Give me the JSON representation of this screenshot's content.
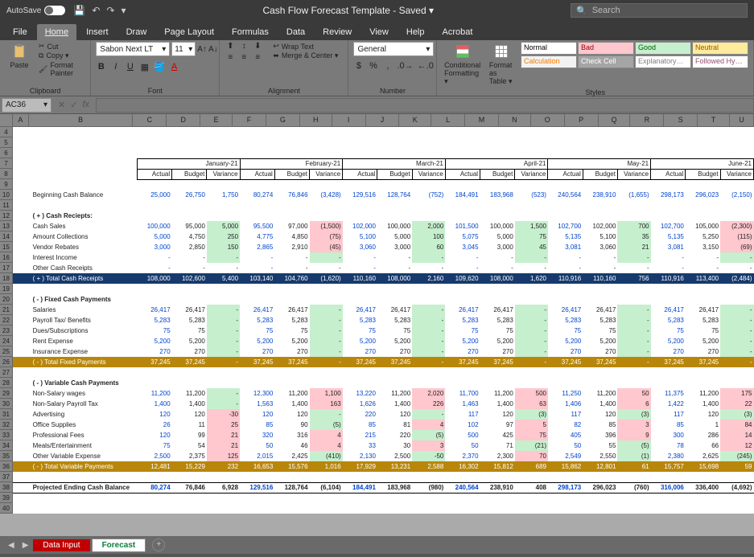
{
  "titlebar": {
    "autosave": "AutoSave",
    "doc": "Cash Flow Forecast Template - Saved ▾",
    "search_ph": "Search"
  },
  "tabs": [
    "File",
    "Home",
    "Insert",
    "Draw",
    "Page Layout",
    "Formulas",
    "Data",
    "Review",
    "View",
    "Help",
    "Acrobat"
  ],
  "active_tab": 1,
  "ribbon": {
    "clipboard": {
      "paste": "Paste",
      "cut": "Cut",
      "copy": "Copy ▾",
      "fp": "Format Painter",
      "label": "Clipboard"
    },
    "font": {
      "name": "Sabon Next LT",
      "size": "11",
      "label": "Font"
    },
    "alignment": {
      "wrap": "Wrap Text",
      "merge": "Merge & Center ▾",
      "label": "Alignment"
    },
    "number": {
      "fmt": "General",
      "label": "Number"
    },
    "styles": {
      "cond": "Conditional Formatting ▾",
      "fat": "Format as Table ▾",
      "label": "Styles",
      "cells": [
        {
          "t": "Normal",
          "bg": "#fff",
          "fg": "#000"
        },
        {
          "t": "Bad",
          "bg": "#ffc7ce",
          "fg": "#9c0006"
        },
        {
          "t": "Good",
          "bg": "#c6efce",
          "fg": "#006100"
        },
        {
          "t": "Neutral",
          "bg": "#ffeb9c",
          "fg": "#9c5700"
        },
        {
          "t": "Calculation",
          "bg": "#f2f2f2",
          "fg": "#fa7d00"
        },
        {
          "t": "Check Cell",
          "bg": "#a5a5a5",
          "fg": "#fff"
        },
        {
          "t": "Explanatory…",
          "bg": "#fff",
          "fg": "#7f7f7f"
        },
        {
          "t": "Followed Hy…",
          "bg": "#fff",
          "fg": "#954f72"
        }
      ]
    }
  },
  "namebox": "AC36",
  "cols": [
    "",
    "A",
    "B",
    "C",
    "D",
    "E",
    "F",
    "G",
    "H",
    "I",
    "J",
    "K",
    "L",
    "M",
    "N",
    "O",
    "P",
    "Q",
    "R",
    "S",
    "T",
    "U"
  ],
  "rows_start": 4,
  "rows_end": 40,
  "months": [
    "January-21",
    "February-21",
    "March-21",
    "April-21",
    "May-21",
    "June-21"
  ],
  "subcols": [
    "Actual",
    "Budget",
    "Variance"
  ],
  "beginning_label": "Beginning Cash Balance",
  "beginning": [
    [
      "25,000",
      "26,750",
      "1,750"
    ],
    [
      "80,274",
      "76,846",
      "(3,428)"
    ],
    [
      "129,516",
      "128,764",
      "(752)"
    ],
    [
      "184,491",
      "183,968",
      "(523)"
    ],
    [
      "240,564",
      "238,910",
      "(1,655)"
    ],
    [
      "298,173",
      "296,023",
      "(2,150)"
    ]
  ],
  "receipts_hdr": "( + ) Cash Reciepts:",
  "receipts": [
    {
      "l": "Cash Sales",
      "v": [
        [
          "100,000",
          "95,000",
          "5,000",
          "g"
        ],
        [
          "95,500",
          "97,000",
          "(1,500)",
          "r"
        ],
        [
          "102,000",
          "100,000",
          "2,000",
          "g"
        ],
        [
          "101,500",
          "100,000",
          "1,500",
          "g"
        ],
        [
          "102,700",
          "102,000",
          "700",
          "g"
        ],
        [
          "102,700",
          "105,000",
          "(2,300)",
          "r"
        ]
      ]
    },
    {
      "l": "Amount Collections",
      "v": [
        [
          "5,000",
          "4,750",
          "250",
          "g"
        ],
        [
          "4,775",
          "4,850",
          "(75)",
          "r"
        ],
        [
          "5,100",
          "5,000",
          "100",
          "g"
        ],
        [
          "5,075",
          "5,000",
          "75",
          "g"
        ],
        [
          "5,135",
          "5,100",
          "35",
          "g"
        ],
        [
          "5,135",
          "5,250",
          "(115)",
          "r"
        ]
      ]
    },
    {
      "l": "Vendor Rebates",
      "v": [
        [
          "3,000",
          "2,850",
          "150",
          "g"
        ],
        [
          "2,865",
          "2,910",
          "(45)",
          "r"
        ],
        [
          "3,060",
          "3,000",
          "60",
          "g"
        ],
        [
          "3,045",
          "3,000",
          "45",
          "g"
        ],
        [
          "3,081",
          "3,060",
          "21",
          "g"
        ],
        [
          "3,081",
          "3,150",
          "(69)",
          "r"
        ]
      ]
    },
    {
      "l": "Interest Income",
      "v": [
        [
          "-",
          "-",
          "-",
          "g"
        ],
        [
          "-",
          "-",
          "-",
          "g"
        ],
        [
          "-",
          "-",
          "-",
          "g"
        ],
        [
          "-",
          "-",
          "-",
          "g"
        ],
        [
          "-",
          "-",
          "-",
          "g"
        ],
        [
          "-",
          "-",
          "-",
          "g"
        ]
      ]
    },
    {
      "l": "Other Cash Receipts",
      "v": [
        [
          "-",
          "-",
          "-",
          ""
        ],
        [
          "-",
          "-",
          "-",
          ""
        ],
        [
          "-",
          "-",
          "-",
          ""
        ],
        [
          "-",
          "-",
          "-",
          ""
        ],
        [
          "-",
          "-",
          "-",
          ""
        ],
        [
          "-",
          "-",
          "-",
          ""
        ]
      ]
    }
  ],
  "receipts_total": {
    "l": "( + ) Total Cash Receipts",
    "v": [
      [
        "108,000",
        "102,600",
        "5,400"
      ],
      [
        "103,140",
        "104,760",
        "(1,620)"
      ],
      [
        "110,160",
        "108,000",
        "2,160"
      ],
      [
        "109,620",
        "108,000",
        "1,620"
      ],
      [
        "110,916",
        "110,160",
        "756"
      ],
      [
        "110,916",
        "113,400",
        "(2,484)"
      ]
    ]
  },
  "fixed_hdr": "( - ) Fixed Cash Payments",
  "fixed": [
    {
      "l": "Salaries",
      "v": [
        [
          "26,417",
          "26,417",
          "-",
          "g"
        ],
        [
          "26,417",
          "26,417",
          "-",
          "g"
        ],
        [
          "26,417",
          "26,417",
          "-",
          "g"
        ],
        [
          "26,417",
          "26,417",
          "-",
          "g"
        ],
        [
          "26,417",
          "26,417",
          "-",
          "g"
        ],
        [
          "26,417",
          "26,417",
          "-",
          "g"
        ]
      ]
    },
    {
      "l": "Payroll Tax/ Benefits",
      "v": [
        [
          "5,283",
          "5,283",
          "-",
          "g"
        ],
        [
          "5,283",
          "5,283",
          "-",
          "g"
        ],
        [
          "5,283",
          "5,283",
          "-",
          "g"
        ],
        [
          "5,283",
          "5,283",
          "-",
          "g"
        ],
        [
          "5,283",
          "5,283",
          "-",
          "g"
        ],
        [
          "5,283",
          "5,283",
          "-",
          "g"
        ]
      ]
    },
    {
      "l": "Dues/Subscriptions",
      "v": [
        [
          "75",
          "75",
          "-",
          "g"
        ],
        [
          "75",
          "75",
          "-",
          "g"
        ],
        [
          "75",
          "75",
          "-",
          "g"
        ],
        [
          "75",
          "75",
          "-",
          "g"
        ],
        [
          "75",
          "75",
          "-",
          "g"
        ],
        [
          "75",
          "75",
          "-",
          "g"
        ]
      ]
    },
    {
      "l": "Rent Expense",
      "v": [
        [
          "5,200",
          "5,200",
          "-",
          "g"
        ],
        [
          "5,200",
          "5,200",
          "-",
          "g"
        ],
        [
          "5,200",
          "5,200",
          "-",
          "g"
        ],
        [
          "5,200",
          "5,200",
          "-",
          "g"
        ],
        [
          "5,200",
          "5,200",
          "-",
          "g"
        ],
        [
          "5,200",
          "5,200",
          "-",
          "g"
        ]
      ]
    },
    {
      "l": "Insurance Expense",
      "v": [
        [
          "270",
          "270",
          "-",
          "g"
        ],
        [
          "270",
          "270",
          "-",
          "g"
        ],
        [
          "270",
          "270",
          "-",
          "g"
        ],
        [
          "270",
          "270",
          "-",
          "g"
        ],
        [
          "270",
          "270",
          "-",
          "g"
        ],
        [
          "270",
          "270",
          "-",
          "g"
        ]
      ]
    }
  ],
  "fixed_total": {
    "l": "( - ) Total Fixed Payments",
    "v": [
      [
        "37,245",
        "37,245",
        "-"
      ],
      [
        "37,245",
        "37,245",
        "-"
      ],
      [
        "37,245",
        "37,245",
        "-"
      ],
      [
        "37,245",
        "37,245",
        "-"
      ],
      [
        "37,245",
        "37,245",
        "-"
      ],
      [
        "37,245",
        "37,245",
        "-"
      ]
    ]
  },
  "var_hdr": "( - ) Variable Cash Payments",
  "variable": [
    {
      "l": "Non-Salary wages",
      "v": [
        [
          "11,200",
          "11,200",
          "-",
          "g"
        ],
        [
          "12,300",
          "11,200",
          "1,100",
          "r"
        ],
        [
          "13,220",
          "11,200",
          "2,020",
          "r"
        ],
        [
          "11,700",
          "11,200",
          "500",
          "r"
        ],
        [
          "11,250",
          "11,200",
          "50",
          "r"
        ],
        [
          "11,375",
          "11,200",
          "175",
          "r"
        ]
      ]
    },
    {
      "l": "Non-Salary Payroll Tax",
      "v": [
        [
          "1,400",
          "1,400",
          "-",
          "g"
        ],
        [
          "1,563",
          "1,400",
          "163",
          "r"
        ],
        [
          "1,626",
          "1,400",
          "226",
          "r"
        ],
        [
          "1,463",
          "1,400",
          "63",
          "r"
        ],
        [
          "1,406",
          "1,400",
          "6",
          "r"
        ],
        [
          "1,422",
          "1,400",
          "22",
          "r"
        ]
      ]
    },
    {
      "l": "Advertising",
      "v": [
        [
          "120",
          "120",
          "-30",
          "r"
        ],
        [
          "120",
          "120",
          "-",
          "g"
        ],
        [
          "220",
          "120",
          "-",
          "g"
        ],
        [
          "117",
          "120",
          "(3)",
          "g"
        ],
        [
          "117",
          "120",
          "(3)",
          "g"
        ],
        [
          "117",
          "120",
          "(3)",
          "g"
        ]
      ]
    },
    {
      "l": "Office Supplies",
      "v": [
        [
          "26",
          "11",
          "25",
          "r"
        ],
        [
          "85",
          "90",
          "(5)",
          "g"
        ],
        [
          "85",
          "81",
          "4",
          "r"
        ],
        [
          "102",
          "97",
          "5",
          "r"
        ],
        [
          "82",
          "85",
          "3",
          "r"
        ],
        [
          "85",
          "1",
          "84",
          "r"
        ]
      ]
    },
    {
      "l": "Professional Fees",
      "v": [
        [
          "120",
          "99",
          "21",
          "r"
        ],
        [
          "320",
          "316",
          "4",
          "r"
        ],
        [
          "215",
          "220",
          "(5)",
          "g"
        ],
        [
          "500",
          "425",
          "75",
          "r"
        ],
        [
          "405",
          "396",
          "9",
          "r"
        ],
        [
          "300",
          "286",
          "14",
          "r"
        ]
      ]
    },
    {
      "l": "Meals/Entertainment",
      "v": [
        [
          "75",
          "54",
          "21",
          "r"
        ],
        [
          "50",
          "46",
          "4",
          "r"
        ],
        [
          "33",
          "30",
          "3",
          "r"
        ],
        [
          "50",
          "71",
          "(21)",
          "g"
        ],
        [
          "50",
          "55",
          "(5)",
          "g"
        ],
        [
          "78",
          "66",
          "12",
          "r"
        ]
      ]
    },
    {
      "l": "Other Variable Expense",
      "v": [
        [
          "2,500",
          "2,375",
          "125",
          "r"
        ],
        [
          "2,015",
          "2,425",
          "(410)",
          "g"
        ],
        [
          "2,130",
          "2,500",
          "-50",
          "g"
        ],
        [
          "2,370",
          "2,300",
          "70",
          "r"
        ],
        [
          "2,549",
          "2,550",
          "(1)",
          "g"
        ],
        [
          "2,380",
          "2,625",
          "(245)",
          "g"
        ]
      ]
    }
  ],
  "var_total": {
    "l": "( - ) Total Variable Payments",
    "v": [
      [
        "12,481",
        "15,229",
        "232"
      ],
      [
        "16,653",
        "15,576",
        "1,016"
      ],
      [
        "17,929",
        "13,231",
        "2,588"
      ],
      [
        "16,302",
        "15,812",
        "689"
      ],
      [
        "15,862",
        "12,801",
        "61"
      ],
      [
        "15,757",
        "15,698",
        "59"
      ]
    ]
  },
  "ending_label": "Projected Ending Cash Balance",
  "ending": [
    [
      "80,274",
      "76,846",
      "6,928"
    ],
    [
      "129,516",
      "128,764",
      "(6,104)"
    ],
    [
      "184,491",
      "183,968",
      "(980)"
    ],
    [
      "240,564",
      "238,910",
      "408"
    ],
    [
      "298,173",
      "296,023",
      "(760)"
    ],
    [
      "316,006",
      "336,400",
      "(4,692)"
    ]
  ],
  "sheet_tabs": {
    "a": "Data Input",
    "b": "Forecast"
  }
}
